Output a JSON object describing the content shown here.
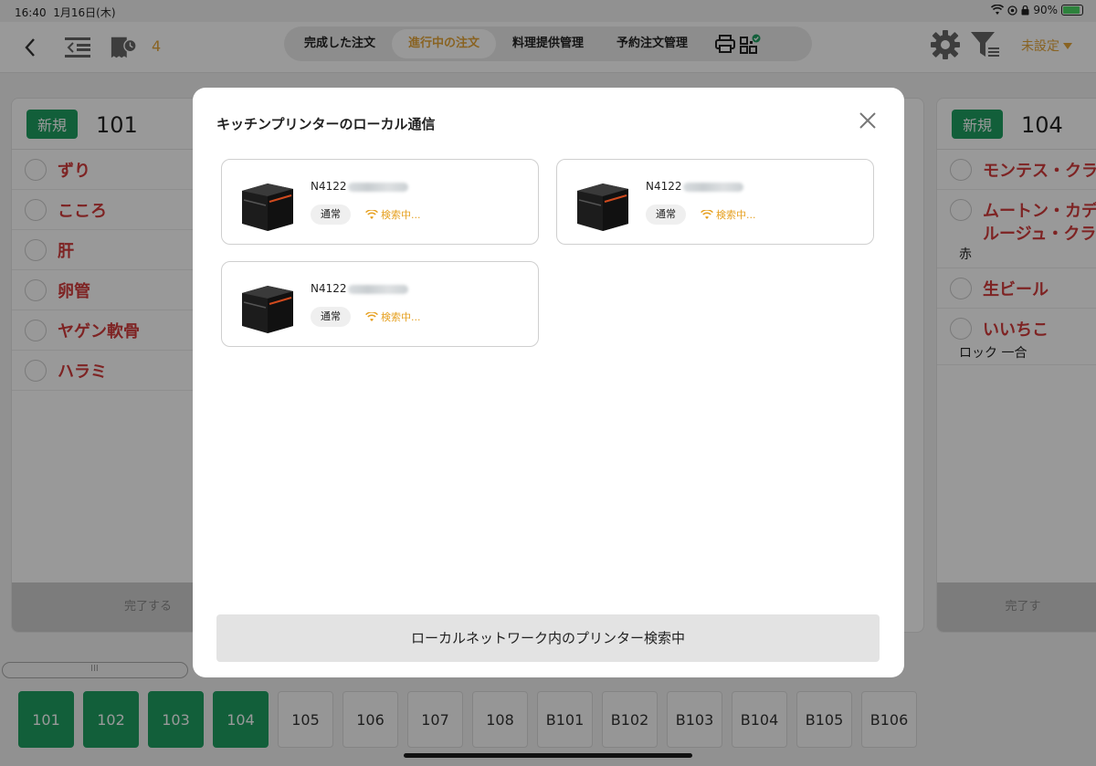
{
  "status_bar": {
    "time": "16:40",
    "date": "1月16日(木)",
    "battery": "90%"
  },
  "top_bar": {
    "count": "4",
    "tabs": [
      {
        "label": "完成した注文",
        "active": false
      },
      {
        "label": "進行中の注文",
        "active": true
      },
      {
        "label": "料理提供管理",
        "active": false
      },
      {
        "label": "予約注文管理",
        "active": false
      }
    ],
    "unset_label": "未設定"
  },
  "panels": [
    {
      "badge": "新規",
      "table": "101",
      "items": [
        {
          "name": "ずり",
          "sub": ""
        },
        {
          "name": "こころ",
          "sub": ""
        },
        {
          "name": "肝",
          "sub": ""
        },
        {
          "name": "卵管",
          "sub": ""
        },
        {
          "name": "ヤゲン軟骨",
          "sub": ""
        },
        {
          "name": "ハラミ",
          "sub": ""
        }
      ],
      "footer": "完了する"
    },
    {
      "badge": "新規",
      "table": "104",
      "items": [
        {
          "name": "モンテス・クラ",
          "sub": ""
        },
        {
          "name": "ムートン・カデ",
          "name2": "ルージュ・クラ",
          "sub": "赤"
        },
        {
          "name": "生ビール",
          "sub": ""
        },
        {
          "name": "いいちこ",
          "sub": "ロック 一合"
        }
      ],
      "footer": "完了す"
    }
  ],
  "table_tabs": [
    {
      "label": "101",
      "active": true
    },
    {
      "label": "102",
      "active": true
    },
    {
      "label": "103",
      "active": true
    },
    {
      "label": "104",
      "active": true
    },
    {
      "label": "105",
      "active": false
    },
    {
      "label": "106",
      "active": false
    },
    {
      "label": "107",
      "active": false
    },
    {
      "label": "108",
      "active": false
    },
    {
      "label": "B101",
      "active": false
    },
    {
      "label": "B102",
      "active": false
    },
    {
      "label": "B103",
      "active": false
    },
    {
      "label": "B104",
      "active": false
    },
    {
      "label": "B105",
      "active": false
    },
    {
      "label": "B106",
      "active": false
    }
  ],
  "modal": {
    "title": "キッチンプリンターのローカル通信",
    "printers": [
      {
        "name_prefix": "N4122",
        "mode": "通常",
        "status": "検索中..."
      },
      {
        "name_prefix": "N4122",
        "mode": "通常",
        "status": "検索中..."
      },
      {
        "name_prefix": "N4122",
        "mode": "通常",
        "status": "検索中..."
      }
    ],
    "button_label": "ローカルネットワーク内のプリンター検索中"
  },
  "colors": {
    "accent": "#e4a53a",
    "green": "#1e9e62",
    "red_text": "#d23b3b"
  },
  "icons": [
    "back-icon",
    "menu-collapse-icon",
    "receipt-clock-icon",
    "printer-icon",
    "qr-check-icon",
    "gear-icon",
    "filter-icon",
    "caret-down-icon",
    "close-icon",
    "wifi-icon"
  ]
}
